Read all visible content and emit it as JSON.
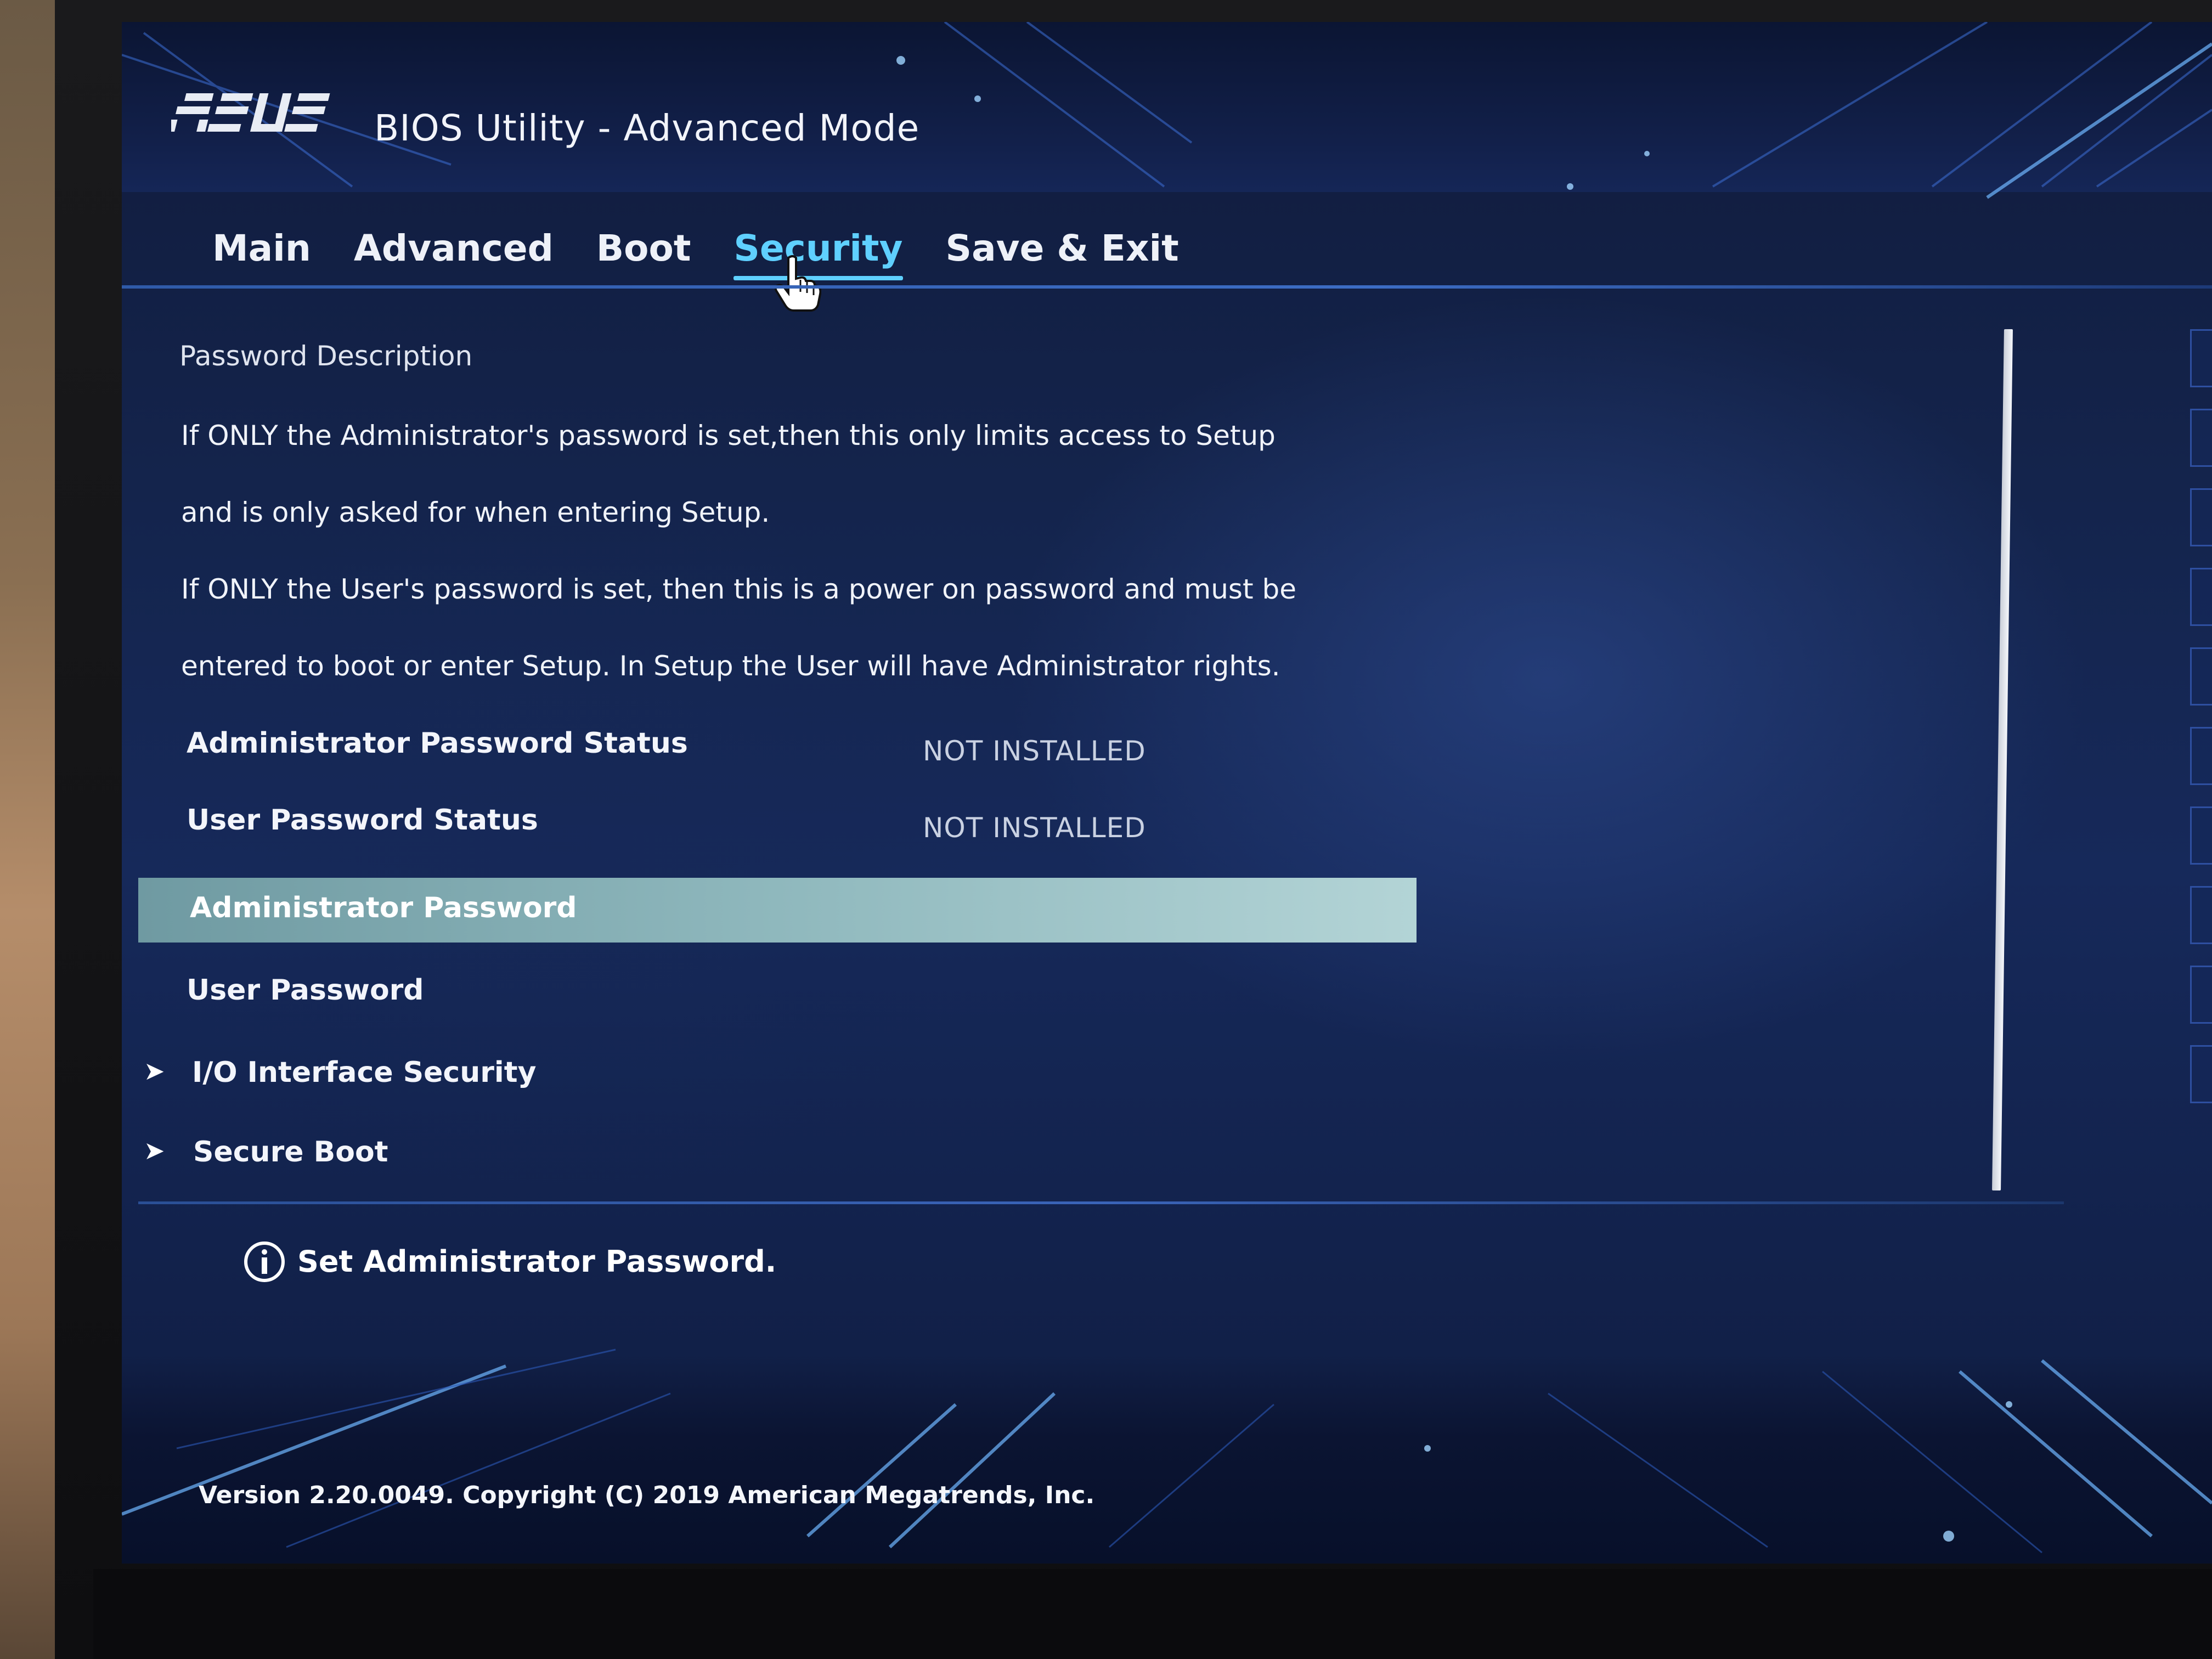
{
  "header": {
    "brand": "ASUS",
    "title": "BIOS Utility - Advanced Mode"
  },
  "tabs": [
    {
      "label": "Main",
      "active": false
    },
    {
      "label": "Advanced",
      "active": false
    },
    {
      "label": "Boot",
      "active": false
    },
    {
      "label": "Security",
      "active": true
    },
    {
      "label": "Save & Exit",
      "active": false
    }
  ],
  "content": {
    "section_title": "Password Description",
    "description": [
      "If ONLY the Administrator's password is set,then this only limits access to Setup",
      "and is only asked for when entering Setup.",
      "If ONLY the User's password is set, then this is a power on password and must be",
      "entered to boot or enter Setup. In Setup the User will have Administrator rights."
    ],
    "status_rows": [
      {
        "label": "Administrator Password Status",
        "value": "NOT INSTALLED"
      },
      {
        "label": "User Password Status",
        "value": "NOT INSTALLED"
      }
    ],
    "items": [
      {
        "label": "Administrator Password",
        "selected": true,
        "submenu": false
      },
      {
        "label": "User Password",
        "selected": false,
        "submenu": false
      },
      {
        "label": "I/O Interface Security",
        "selected": false,
        "submenu": true
      },
      {
        "label": "Secure Boot",
        "selected": false,
        "submenu": true
      }
    ],
    "submenu_arrow": "➤"
  },
  "help": {
    "icon": "info-icon",
    "text": "Set Administrator Password."
  },
  "footer": {
    "text": "Version 2.20.0049. Copyright (C) 2019 American Megatrends, Inc."
  },
  "colors": {
    "accent": "#5fd0ff",
    "highlight": "#a7cbd0",
    "background": "#14244c"
  }
}
